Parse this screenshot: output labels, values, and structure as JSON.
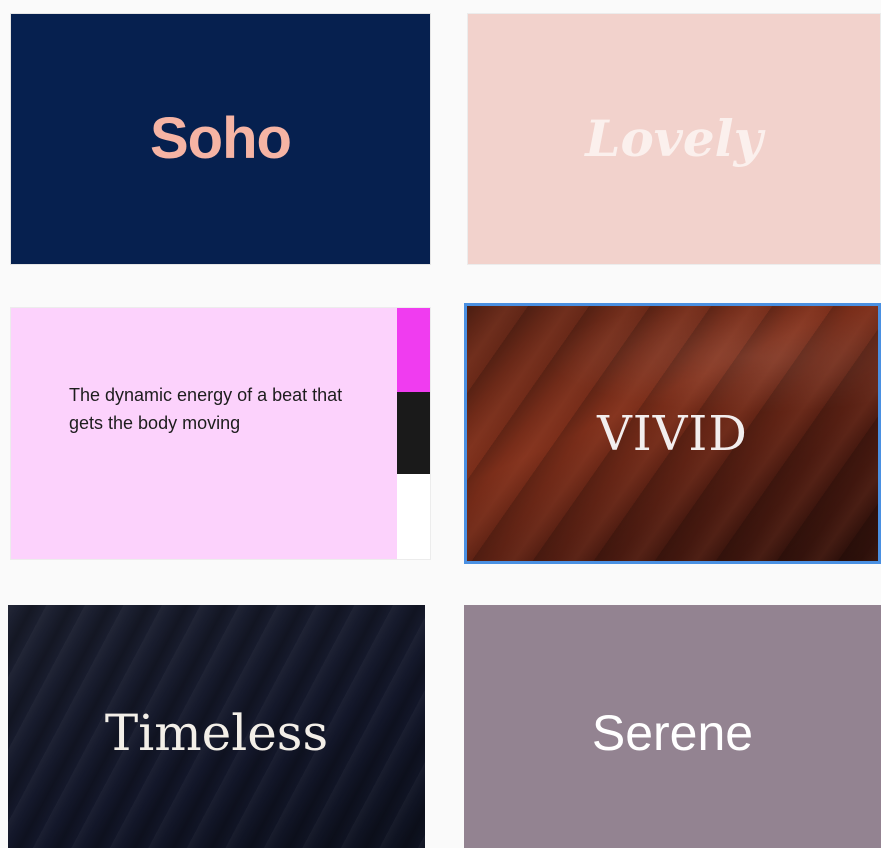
{
  "cards": [
    {
      "id": "soho",
      "title": "Soho",
      "background": "#06204f",
      "text_color": "#f6b4a4"
    },
    {
      "id": "lovely",
      "title": "Lovely",
      "background": "#f2d2cc",
      "text_color": "#fbf0ed"
    },
    {
      "id": "dynamic",
      "body": "The dynamic energy of a beat that gets the body moving",
      "background": "#fcd2fc",
      "swatches": [
        "#f03cf0",
        "#1a1a1a",
        "#ffffff"
      ]
    },
    {
      "id": "vivid",
      "title": "VIVID",
      "background": "#6b2818",
      "selected": true,
      "selection_color": "#4a90e2"
    },
    {
      "id": "timeless",
      "title": "Timeless",
      "background": "#13172a"
    },
    {
      "id": "serene",
      "title": "Serene",
      "background": "#938391"
    }
  ]
}
